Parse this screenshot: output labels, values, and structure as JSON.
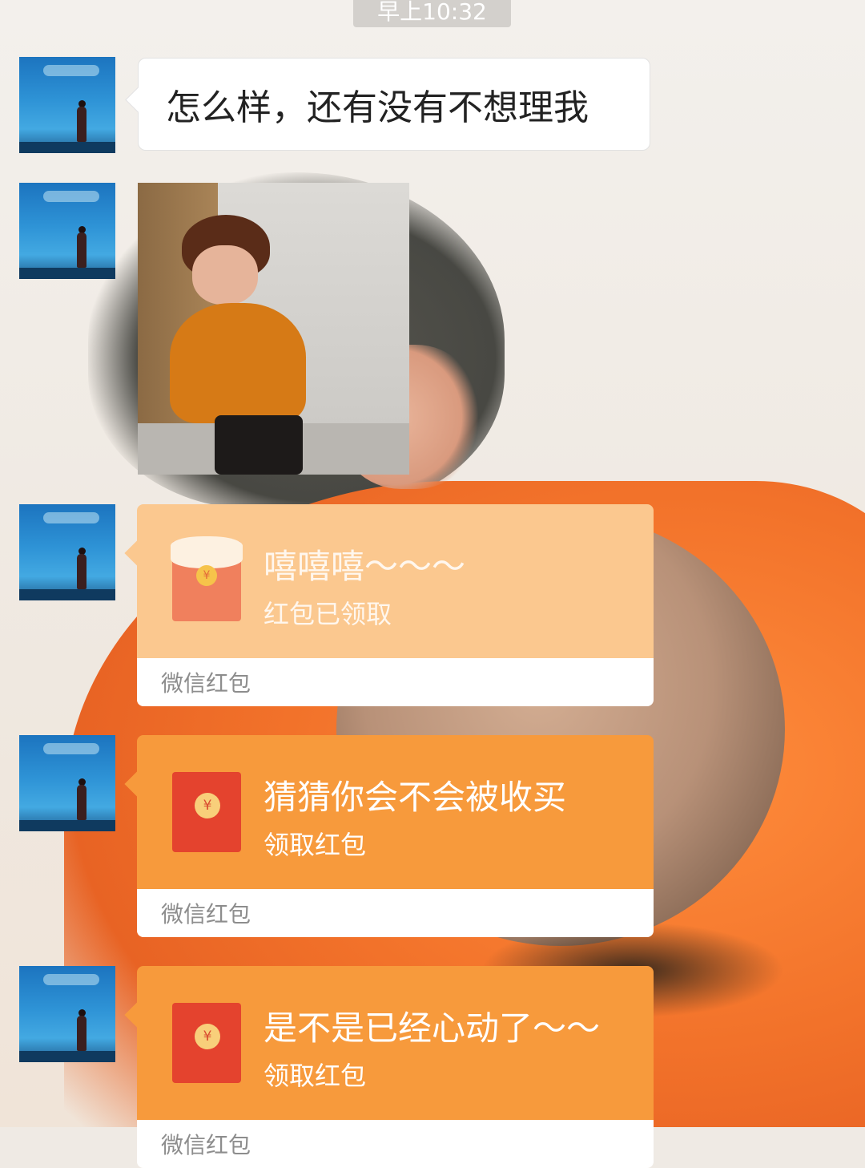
{
  "timestamp": "早上10:32",
  "messages": {
    "text": "怎么样，还有没有不想理我",
    "red_packets": [
      {
        "title": "嘻嘻嘻～～～",
        "status": "红包已领取",
        "footer": "微信红包",
        "state": "opened"
      },
      {
        "title": "猜猜你会不会被收买",
        "status": "领取红包",
        "footer": "微信红包",
        "state": "unopened"
      },
      {
        "title": "是不是已经心动了～～",
        "status": "领取红包",
        "footer": "微信红包",
        "state": "unopened"
      }
    ]
  },
  "colors": {
    "opened_packet": "#fbc88f",
    "unopened_packet": "#f79a3c",
    "envelope_red": "#e4432e"
  },
  "icons": {
    "yuan_symbol": "¥"
  }
}
